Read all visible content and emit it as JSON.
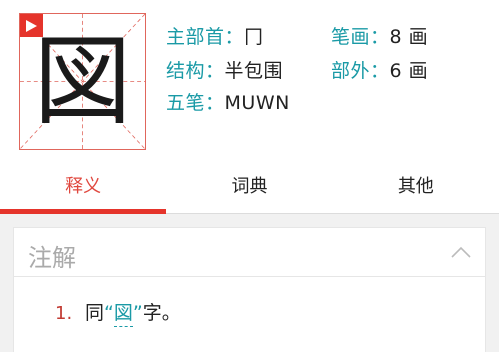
{
  "header": {
    "character": "図",
    "play_icon": "play-icon",
    "info": {
      "radical_label": "主部首：",
      "radical_value": "冂",
      "strokes_label": "笔画：",
      "strokes_value": "8 画",
      "structure_label": "结构：",
      "structure_value": "半包围",
      "outer_label": "部外：",
      "outer_value": "6 画",
      "wubi_label": "五笔：",
      "wubi_value": "MUWN"
    }
  },
  "tabs": [
    {
      "label": "释义",
      "active": true
    },
    {
      "label": "词典",
      "active": false
    },
    {
      "label": "其他",
      "active": false
    }
  ],
  "section": {
    "title": "注解",
    "collapse_icon": "chevron-up-icon",
    "entries": [
      {
        "num": "1.",
        "prefix": "同",
        "open_quote": "“",
        "ref": "図",
        "close_quote": "”",
        "suffix": "字。"
      }
    ]
  },
  "colors": {
    "accent_red": "#e5342b",
    "teal_label": "#1a9aa6",
    "grid_red": "#e0665c"
  }
}
